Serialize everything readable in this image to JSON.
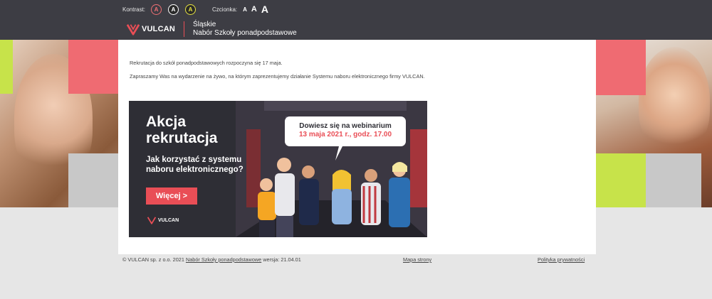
{
  "accessibility": {
    "contrast_label": "Kontrast:",
    "contrast_glyph": "A",
    "font_label": "Czcionka:",
    "font_glyph": "A"
  },
  "brand": {
    "logo_text": "VULCAN",
    "region": "Śląskie",
    "system_name": "Nabór Szkoły ponadpodstawowe"
  },
  "content": {
    "line1": "Rekrutacja do szkół ponadpodstawowych rozpoczyna się 17 maja.",
    "line2": "Zapraszamy Was na wydarzenie na żywo, na którym zaprezentujemy działanie Systemu naboru elektronicznego firmy VULCAN."
  },
  "banner": {
    "title_line1": "Akcja",
    "title_line2": "rekrutacja",
    "subtitle_line1": "Jak korzystać z systemu",
    "subtitle_line2": "naboru elektronicznego?",
    "button_label": "Więcej >",
    "bubble_line1": "Dowiesz się na webinarium",
    "bubble_line2": "13 maja 2021 r., godz. 17.00",
    "logo_text": "VULCAN"
  },
  "footer": {
    "copyright": "© VULCAN sp. z o.o. 2021",
    "system_link": "Nabór Szkoły ponadpodstawowe",
    "version": "wersja: 21.04.01",
    "sitemap": "Mapa strony",
    "privacy": "Polityka prywatności"
  },
  "colors": {
    "header_bg": "#3d3d44",
    "accent_red": "#e94e56",
    "accent_pink": "#ef6b72",
    "accent_lime": "#c7e34a",
    "panel_gray": "#c8c8c8",
    "footer_bg": "#e6e6e6"
  }
}
